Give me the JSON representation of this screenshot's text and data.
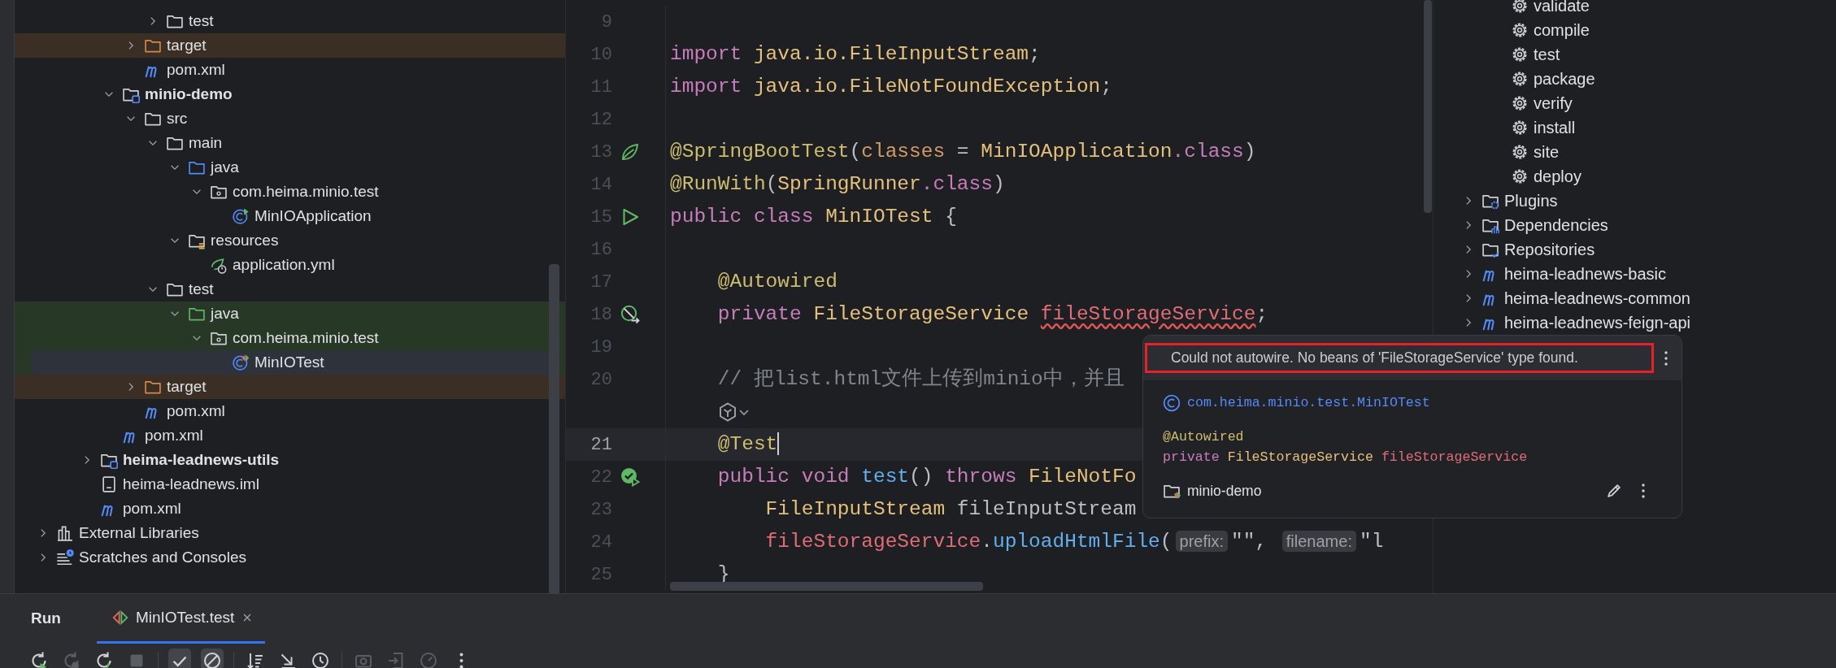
{
  "project_tree": [
    {
      "children": [
        {
          "children": [
            {
              "children": [
                {
                  "children": [
                    {
                      "children": [
                        {
                          "label": "test",
                          "kind": "folder",
                          "expanded": false,
                          "selected": false
                        }
                      ]
                    },
                    {
                      "label": "target",
                      "kind": "excluded-folder",
                      "expanded": false,
                      "selected": false
                    },
                    {
                      "label": "pom.xml",
                      "kind": "maven",
                      "selected": false
                    }
                  ]
                },
                {
                  "label": "minio-demo",
                  "kind": "module",
                  "expanded": true,
                  "selected": false,
                  "children": [
                    {
                      "label": "src",
                      "kind": "folder",
                      "expanded": true,
                      "selected": false,
                      "children": [
                        {
                          "label": "main",
                          "kind": "folder",
                          "expanded": true,
                          "selected": false,
                          "children": [
                            {
                              "label": "java",
                              "kind": "source-root",
                              "expanded": true,
                              "selected": false,
                              "children": [
                                {
                                  "label": "com.heima.minio.test",
                                  "kind": "package",
                                  "expanded": true,
                                  "selected": false,
                                  "children": [
                                    {
                                      "label": "MinIOApplication",
                                      "kind": "class-run",
                                      "selected": false
                                    }
                                  ]
                                }
                              ]
                            },
                            {
                              "label": "resources",
                              "kind": "resources",
                              "expanded": true,
                              "selected": false,
                              "children": [
                                {
                                  "label": "application.yml",
                                  "kind": "spring-config",
                                  "selected": false
                                }
                              ]
                            }
                          ]
                        },
                        {
                          "label": "test",
                          "kind": "folder",
                          "expanded": true,
                          "selected": false,
                          "children": [
                            {
                              "label": "java",
                              "kind": "test-root",
                              "expanded": true,
                              "selected": false,
                              "children": [
                                {
                                  "label": "com.heima.minio.test",
                                  "kind": "package",
                                  "expanded": true,
                                  "selected": false,
                                  "children": [
                                    {
                                      "label": "MinIOTest",
                                      "kind": "class-test",
                                      "selected": true
                                    }
                                  ]
                                }
                              ]
                            }
                          ]
                        }
                      ]
                    },
                    {
                      "label": "target",
                      "kind": "excluded-folder",
                      "expanded": false,
                      "selected": false
                    },
                    {
                      "label": "pom.xml",
                      "kind": "maven",
                      "selected": false
                    }
                  ]
                },
                {
                  "label": "pom.xml",
                  "kind": "maven",
                  "selected": false
                }
              ]
            },
            {
              "label": "heima-leadnews-utils",
              "kind": "module",
              "expanded": false,
              "selected": false
            },
            {
              "label": "heima-leadnews.iml",
              "kind": "iml",
              "selected": false
            },
            {
              "label": "pom.xml",
              "kind": "maven",
              "selected": false
            }
          ]
        }
      ]
    },
    {
      "label": "External Libraries",
      "kind": "libraries",
      "expanded": false,
      "selected": false
    },
    {
      "label": "Scratches and Consoles",
      "kind": "scratches",
      "expanded": false,
      "selected": false
    }
  ],
  "editor": {
    "lines": [
      {
        "number": "9",
        "current": false
      },
      {
        "number": "10",
        "current": false,
        "tokens": [
          {
            "kind": "keyword",
            "text": "import "
          },
          {
            "kind": "type",
            "text": "java.io.FileInputStream"
          },
          {
            "kind": "plain",
            "text": ";"
          }
        ]
      },
      {
        "number": "11",
        "current": false,
        "tokens": [
          {
            "kind": "keyword",
            "text": "import "
          },
          {
            "kind": "type",
            "text": "java.io.FileNotFoundException"
          },
          {
            "kind": "plain",
            "text": ";"
          }
        ]
      },
      {
        "number": "12",
        "current": false
      },
      {
        "number": "13",
        "current": false,
        "gutter": {
          "kind": "spring"
        },
        "tokens": [
          {
            "kind": "annotation",
            "text": "@SpringBootTest"
          },
          {
            "kind": "plain",
            "text": "("
          },
          {
            "kind": "param",
            "text": "classes"
          },
          {
            "kind": "plain",
            "text": " = "
          },
          {
            "kind": "type",
            "text": "MinIOApplication"
          },
          {
            "kind": "keyword",
            "text": ".class"
          },
          {
            "kind": "plain",
            "text": ")"
          }
        ]
      },
      {
        "number": "14",
        "current": false,
        "tokens": [
          {
            "kind": "annotation",
            "text": "@RunWith"
          },
          {
            "kind": "plain",
            "text": "("
          },
          {
            "kind": "type",
            "text": "SpringRunner"
          },
          {
            "kind": "keyword",
            "text": ".class"
          },
          {
            "kind": "plain",
            "text": ")"
          }
        ]
      },
      {
        "number": "15",
        "current": false,
        "gutter": {
          "kind": "run"
        },
        "tokens": [
          {
            "kind": "keyword",
            "text": "public class "
          },
          {
            "kind": "type",
            "text": "MinIOTest"
          },
          {
            "kind": "plain",
            "text": " {"
          }
        ]
      },
      {
        "number": "16",
        "current": false
      },
      {
        "number": "17",
        "current": false,
        "tokens": [
          {
            "kind": "annotation",
            "text": "    @Autowired"
          }
        ]
      },
      {
        "number": "18",
        "current": false,
        "gutter": {
          "kind": "bean"
        },
        "tokens": [
          {
            "kind": "keyword",
            "text": "    private "
          },
          {
            "kind": "type",
            "text": "FileStorageService "
          },
          {
            "kind": "error",
            "text": "fileStorageService"
          },
          {
            "kind": "plain",
            "text": ";"
          }
        ]
      },
      {
        "number": "19",
        "current": false
      },
      {
        "number": "20",
        "current": false,
        "tokens": [
          {
            "kind": "comment",
            "text": "    // 把list.html文件上传到minio中，并且"
          }
        ]
      },
      {
        "kind": "inlay",
        "current": false
      },
      {
        "number": "21",
        "current": true,
        "tokens": [
          {
            "kind": "annotation",
            "text": "    @Test"
          }
        ]
      },
      {
        "number": "22",
        "current": false,
        "gutter": {
          "kind": "test-passed"
        },
        "tokens": [
          {
            "kind": "keyword",
            "text": "    public void "
          },
          {
            "kind": "method",
            "text": "test"
          },
          {
            "kind": "plain",
            "text": "() "
          },
          {
            "kind": "keyword",
            "text": "throws "
          },
          {
            "kind": "type",
            "text": "FileNotFo"
          }
        ]
      },
      {
        "number": "23",
        "current": false,
        "tokens": [
          {
            "kind": "type",
            "text": "        FileInputStream "
          },
          {
            "kind": "plain",
            "text": "fileInputStream"
          }
        ]
      },
      {
        "number": "24",
        "current": false,
        "tokens": [
          {
            "kind": "field",
            "text": "        fileStorageService"
          },
          {
            "kind": "plain",
            "text": "."
          },
          {
            "kind": "method",
            "text": "uploadHtmlFile"
          },
          {
            "kind": "plain",
            "text": "("
          },
          {
            "kind": "hint",
            "text": "prefix:"
          },
          {
            "kind": "string",
            "text": "\"\""
          },
          {
            "kind": "plain",
            "text": ", "
          },
          {
            "kind": "hint",
            "text": "filename:"
          },
          {
            "kind": "string",
            "text": "\"l"
          }
        ]
      },
      {
        "number": "25",
        "current": false,
        "tokens": [
          {
            "kind": "plain",
            "text": "    }"
          }
        ]
      }
    ]
  },
  "maven_tree": [
    {
      "children": [
        {
          "children": [
            {
              "label": "validate",
              "kind": "goal"
            },
            {
              "label": "compile",
              "kind": "goal"
            },
            {
              "label": "test",
              "kind": "goal"
            },
            {
              "label": "package",
              "kind": "goal"
            },
            {
              "label": "verify",
              "kind": "goal"
            },
            {
              "label": "install",
              "kind": "goal"
            },
            {
              "label": "site",
              "kind": "goal"
            },
            {
              "label": "deploy",
              "kind": "goal"
            }
          ]
        },
        {
          "label": "Plugins",
          "kind": "plugins",
          "expanded": false
        },
        {
          "label": "Dependencies",
          "kind": "dependencies",
          "expanded": false
        },
        {
          "label": "Repositories",
          "kind": "repositories",
          "expanded": false
        },
        {
          "label": "heima-leadnews-basic",
          "kind": "maven",
          "expanded": false
        },
        {
          "label": "heima-leadnews-common",
          "kind": "maven",
          "expanded": false
        },
        {
          "label": "heima-leadnews-feign-api",
          "kind": "maven",
          "expanded": false
        }
      ]
    }
  ],
  "popup": {
    "message": "Could not autowire. No beans of 'FileStorageService' type found.",
    "class_name": "com.heima.minio.test.MinIOTest",
    "code": [
      [
        {
          "kind": "annotation",
          "text": "@Autowired"
        }
      ],
      [
        {
          "kind": "keyword",
          "text": "private "
        },
        {
          "kind": "type",
          "text": "FileStorageService "
        },
        {
          "kind": "field",
          "text": "fileStorageService"
        }
      ]
    ],
    "module": "minio-demo"
  },
  "run_panel": {
    "title": "Run",
    "tabs": [
      {
        "label": "MinIOTest.test",
        "selected": true
      }
    ],
    "toolbar": [
      {
        "kind": "rerun",
        "disabled": false,
        "selected": false
      },
      {
        "kind": "rerun-failed",
        "disabled": true,
        "selected": false
      },
      {
        "kind": "toggle-auto",
        "disabled": false,
        "selected": false
      },
      {
        "kind": "stop",
        "disabled": true,
        "selected": false
      },
      {
        "kind": "separator"
      },
      {
        "kind": "show-passed",
        "disabled": false,
        "selected": true
      },
      {
        "kind": "show-ignored",
        "disabled": false,
        "selected": true
      },
      {
        "kind": "separator"
      },
      {
        "kind": "sort",
        "disabled": false,
        "selected": false
      },
      {
        "kind": "collapse",
        "disabled": false,
        "selected": false
      },
      {
        "kind": "history",
        "disabled": false,
        "selected": false
      },
      {
        "kind": "separator"
      },
      {
        "kind": "screenshot",
        "disabled": true,
        "selected": false
      },
      {
        "kind": "import",
        "disabled": true,
        "selected": false
      },
      {
        "kind": "gauge",
        "disabled": true,
        "selected": false
      },
      {
        "kind": "more",
        "disabled": false,
        "selected": false
      }
    ]
  }
}
